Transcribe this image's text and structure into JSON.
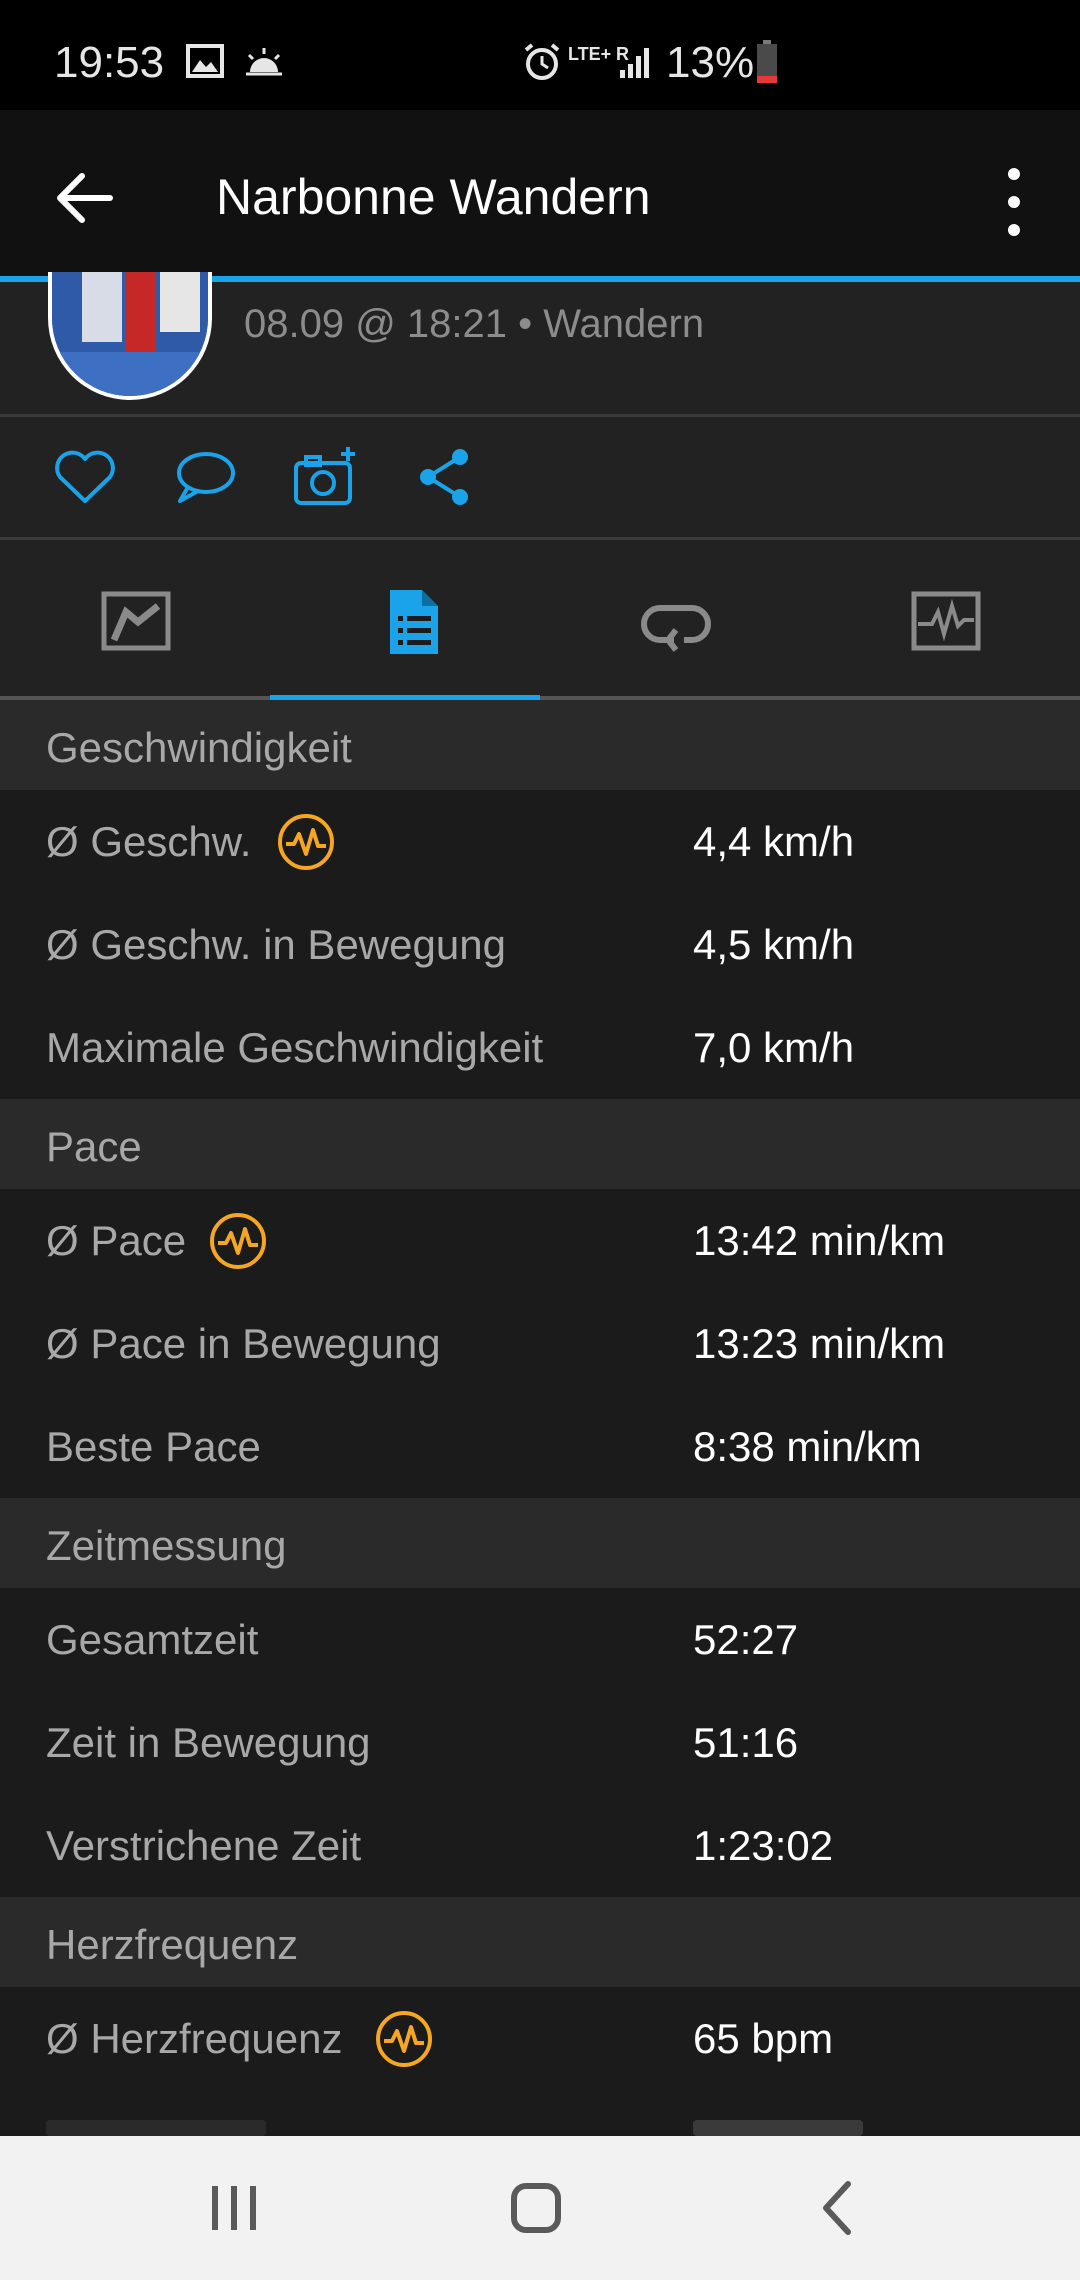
{
  "status_bar": {
    "time": "19:53",
    "network": "LTE+",
    "roaming": "R",
    "battery": "13%",
    "icons": [
      "image-icon",
      "weather-icon",
      "alarm-icon",
      "signal-icon",
      "battery-icon"
    ]
  },
  "app_bar": {
    "title": "Narbonne Wandern",
    "back_icon": "arrow-left-icon",
    "more_icon": "more-vert-icon"
  },
  "header": {
    "subtitle": "08.09 @ 18:21 • Wandern"
  },
  "social": [
    "heart-icon",
    "comment-icon",
    "add-photo-icon",
    "share-icon"
  ],
  "tabs": [
    {
      "icon": "map-icon",
      "active": false
    },
    {
      "icon": "stats-list-icon",
      "active": true
    },
    {
      "icon": "laps-icon",
      "active": false
    },
    {
      "icon": "graph-icon",
      "active": false
    }
  ],
  "sections": {
    "speed": {
      "title": "Geschwindigkeit",
      "rows": [
        {
          "label": "Ø Geschw.",
          "value": "4,4 km/h",
          "badge": true
        },
        {
          "label": "Ø Geschw. in Bewegung",
          "value": "4,5 km/h"
        },
        {
          "label": "Maximale Geschwindigkeit",
          "value": "7,0 km/h"
        }
      ]
    },
    "pace": {
      "title": "Pace",
      "rows": [
        {
          "label": "Ø Pace",
          "value": "13:42 min/km",
          "badge": true
        },
        {
          "label": "Ø Pace in Bewegung",
          "value": "13:23 min/km"
        },
        {
          "label": "Beste Pace",
          "value": "8:38 min/km"
        }
      ]
    },
    "timing": {
      "title": "Zeitmessung",
      "rows": [
        {
          "label": "Gesamtzeit",
          "value": "52:27"
        },
        {
          "label": "Zeit in Bewegung",
          "value": "51:16"
        },
        {
          "label": "Verstrichene Zeit",
          "value": "1:23:02"
        }
      ]
    },
    "heart": {
      "title": "Herzfrequenz",
      "rows": [
        {
          "label": "Ø Herzfrequenz",
          "value": "65 bpm",
          "badge": true
        }
      ]
    }
  },
  "colors": {
    "accent": "#1aa3e8",
    "badge": "#f5a623",
    "background": "#1b1b1b",
    "section": "#2a2a2a"
  },
  "nav": [
    "recent-apps-icon",
    "home-icon",
    "back-icon"
  ]
}
